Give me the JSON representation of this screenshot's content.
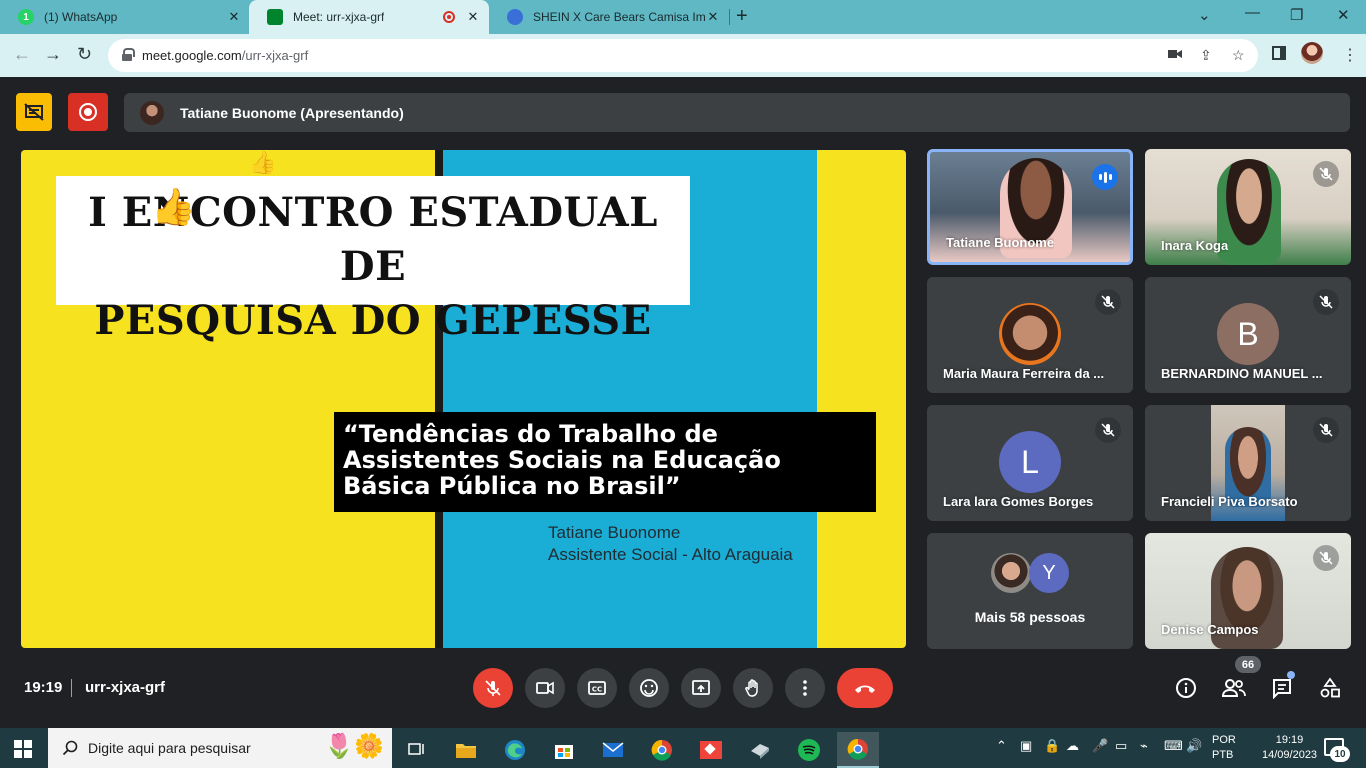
{
  "browser": {
    "tabs": [
      {
        "title": "(1) WhatsApp",
        "icon": "whatsapp-icon"
      },
      {
        "title": "Meet: urr-xjxa-grf",
        "icon": "meet-icon",
        "recording": true
      },
      {
        "title": "SHEIN X Care Bears Camisa Impr",
        "icon": "shein-icon"
      }
    ],
    "url_host": "meet.google.com",
    "url_path": "/urr-xjxa-grf"
  },
  "meet": {
    "presenter_label": "Tatiane Buonome (Apresentando)",
    "time": "19:19",
    "meeting_code": "urr-xjxa-grf",
    "participant_count": "66"
  },
  "slide": {
    "title_line1": "I ENCONTRO ESTADUAL DE",
    "title_line2": "PESQUISA DO GEPESSE",
    "quote_line1": "“Tendências do Trabalho de",
    "quote_line2": "Assistentes Sociais na Educação",
    "quote_line3": "Básica Pública no Brasil”",
    "author_name": "Tatiane Buonome",
    "author_role": "Assistente Social - Alto Araguaia"
  },
  "participants": [
    {
      "name": "Tatiane Buonome",
      "speaking": true
    },
    {
      "name": "Inara Koga",
      "muted": true
    },
    {
      "name": "Maria Maura Ferreira da ...",
      "muted": true
    },
    {
      "name": "BERNARDINO MANUEL ...",
      "muted": true,
      "initial": "B"
    },
    {
      "name": "Lara lara Gomes Borges",
      "muted": true,
      "initial": "L"
    },
    {
      "name": "Francieli Piva Borsato",
      "muted": true
    },
    {
      "name": "Mais 58 pessoas",
      "initial": "Y"
    },
    {
      "name": "Denise Campos",
      "muted": true
    }
  ],
  "taskbar": {
    "search_placeholder": "Digite aqui para pesquisar",
    "lang_line1": "POR",
    "lang_line2": "PTB",
    "clock_time": "19:19",
    "clock_date": "14/09/2023",
    "notifications": "10"
  },
  "colors": {
    "meet_bg": "#202124",
    "tile_bg": "#3c4043",
    "end_call": "#ea4335",
    "slide_yellow": "#f6e21f",
    "slide_blue": "#1aadd6",
    "chrome_tabbar": "#5fb8c4"
  }
}
